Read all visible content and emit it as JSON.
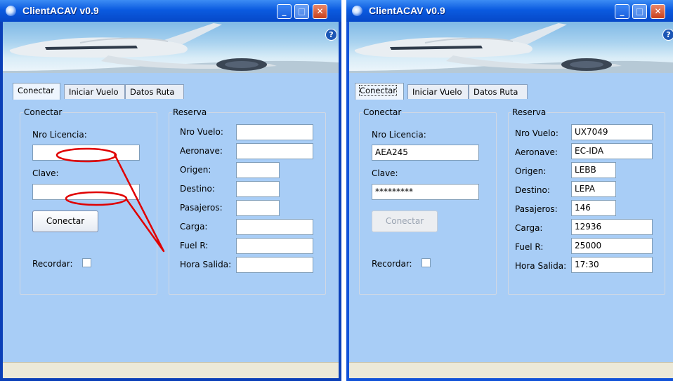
{
  "left": {
    "title": "ClientACAV v0.9",
    "tabs": [
      "Conectar",
      "Iniciar Vuelo",
      "Datos Ruta"
    ],
    "conectar": {
      "legend": "Conectar",
      "licencia_label": "Nro Licencia:",
      "licencia_value": "",
      "clave_label": "Clave:",
      "clave_value": "",
      "button": "Conectar",
      "recordar_label": "Recordar:"
    },
    "reserva": {
      "legend": "Reserva",
      "fields": [
        {
          "label": "Nro Vuelo:",
          "value": ""
        },
        {
          "label": "Aeronave:",
          "value": ""
        },
        {
          "label": "Origen:",
          "value": ""
        },
        {
          "label": "Destino:",
          "value": ""
        },
        {
          "label": "Pasajeros:",
          "value": ""
        },
        {
          "label": "Carga:",
          "value": ""
        },
        {
          "label": "Fuel R:",
          "value": ""
        },
        {
          "label": "Hora Salida:",
          "value": ""
        }
      ]
    }
  },
  "right": {
    "title": "ClientACAV v0.9",
    "tabs": [
      "Conectar",
      "Iniciar Vuelo",
      "Datos Ruta"
    ],
    "conectar": {
      "legend": "Conectar",
      "licencia_label": "Nro Licencia:",
      "licencia_value": "AEA245",
      "clave_label": "Clave:",
      "clave_value": "*********",
      "button": "Conectar",
      "recordar_label": "Recordar:"
    },
    "reserva": {
      "legend": "Reserva",
      "fields": [
        {
          "label": "Nro Vuelo:",
          "value": "UX7049"
        },
        {
          "label": "Aeronave:",
          "value": "EC-IDA"
        },
        {
          "label": "Origen:",
          "value": "LEBB"
        },
        {
          "label": "Destino:",
          "value": "LEPA"
        },
        {
          "label": "Pasajeros:",
          "value": "146"
        },
        {
          "label": "Carga:",
          "value": "12936"
        },
        {
          "label": "Fuel R:",
          "value": "25000"
        },
        {
          "label": "Hora Salida:",
          "value": "17:30"
        }
      ]
    }
  },
  "colors": {
    "titlebar": "#0b5be0",
    "client_bg": "#a8cdf6",
    "annotation": "#e00000"
  },
  "icons": [
    "app-icon",
    "minimize-icon",
    "maximize-icon",
    "close-icon",
    "help-icon",
    "airplane-banner"
  ]
}
